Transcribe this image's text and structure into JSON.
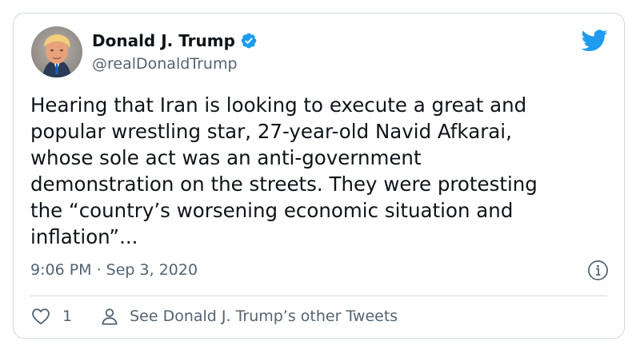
{
  "author": {
    "display_name": "Donald J. Trump",
    "handle": "@realDonaldTrump",
    "verified": true,
    "avatar_icon": "avatar"
  },
  "tweet": {
    "text": "Hearing that Iran is looking to execute a great and\npopular wrestling star, 27-year-old Navid Afkarai,\nwhose sole act was an anti-government\ndemonstration on the streets. They were protesting\nthe “country’s worsening economic situation and\ninflation”...",
    "timestamp": "9:06 PM · Sep 3, 2020"
  },
  "actions": {
    "like_count": "1",
    "other_tweets_label": "See Donald J. Trump’s other Tweets"
  },
  "icons": {
    "brand": "twitter-bird-icon",
    "verified": "verified-badge-icon",
    "info": "info-icon",
    "like": "heart-icon",
    "profile": "person-icon"
  },
  "colors": {
    "brand": "#1d9bf0",
    "text": "#0f1419",
    "secondary_text": "#536471",
    "border": "#cfd9de"
  }
}
